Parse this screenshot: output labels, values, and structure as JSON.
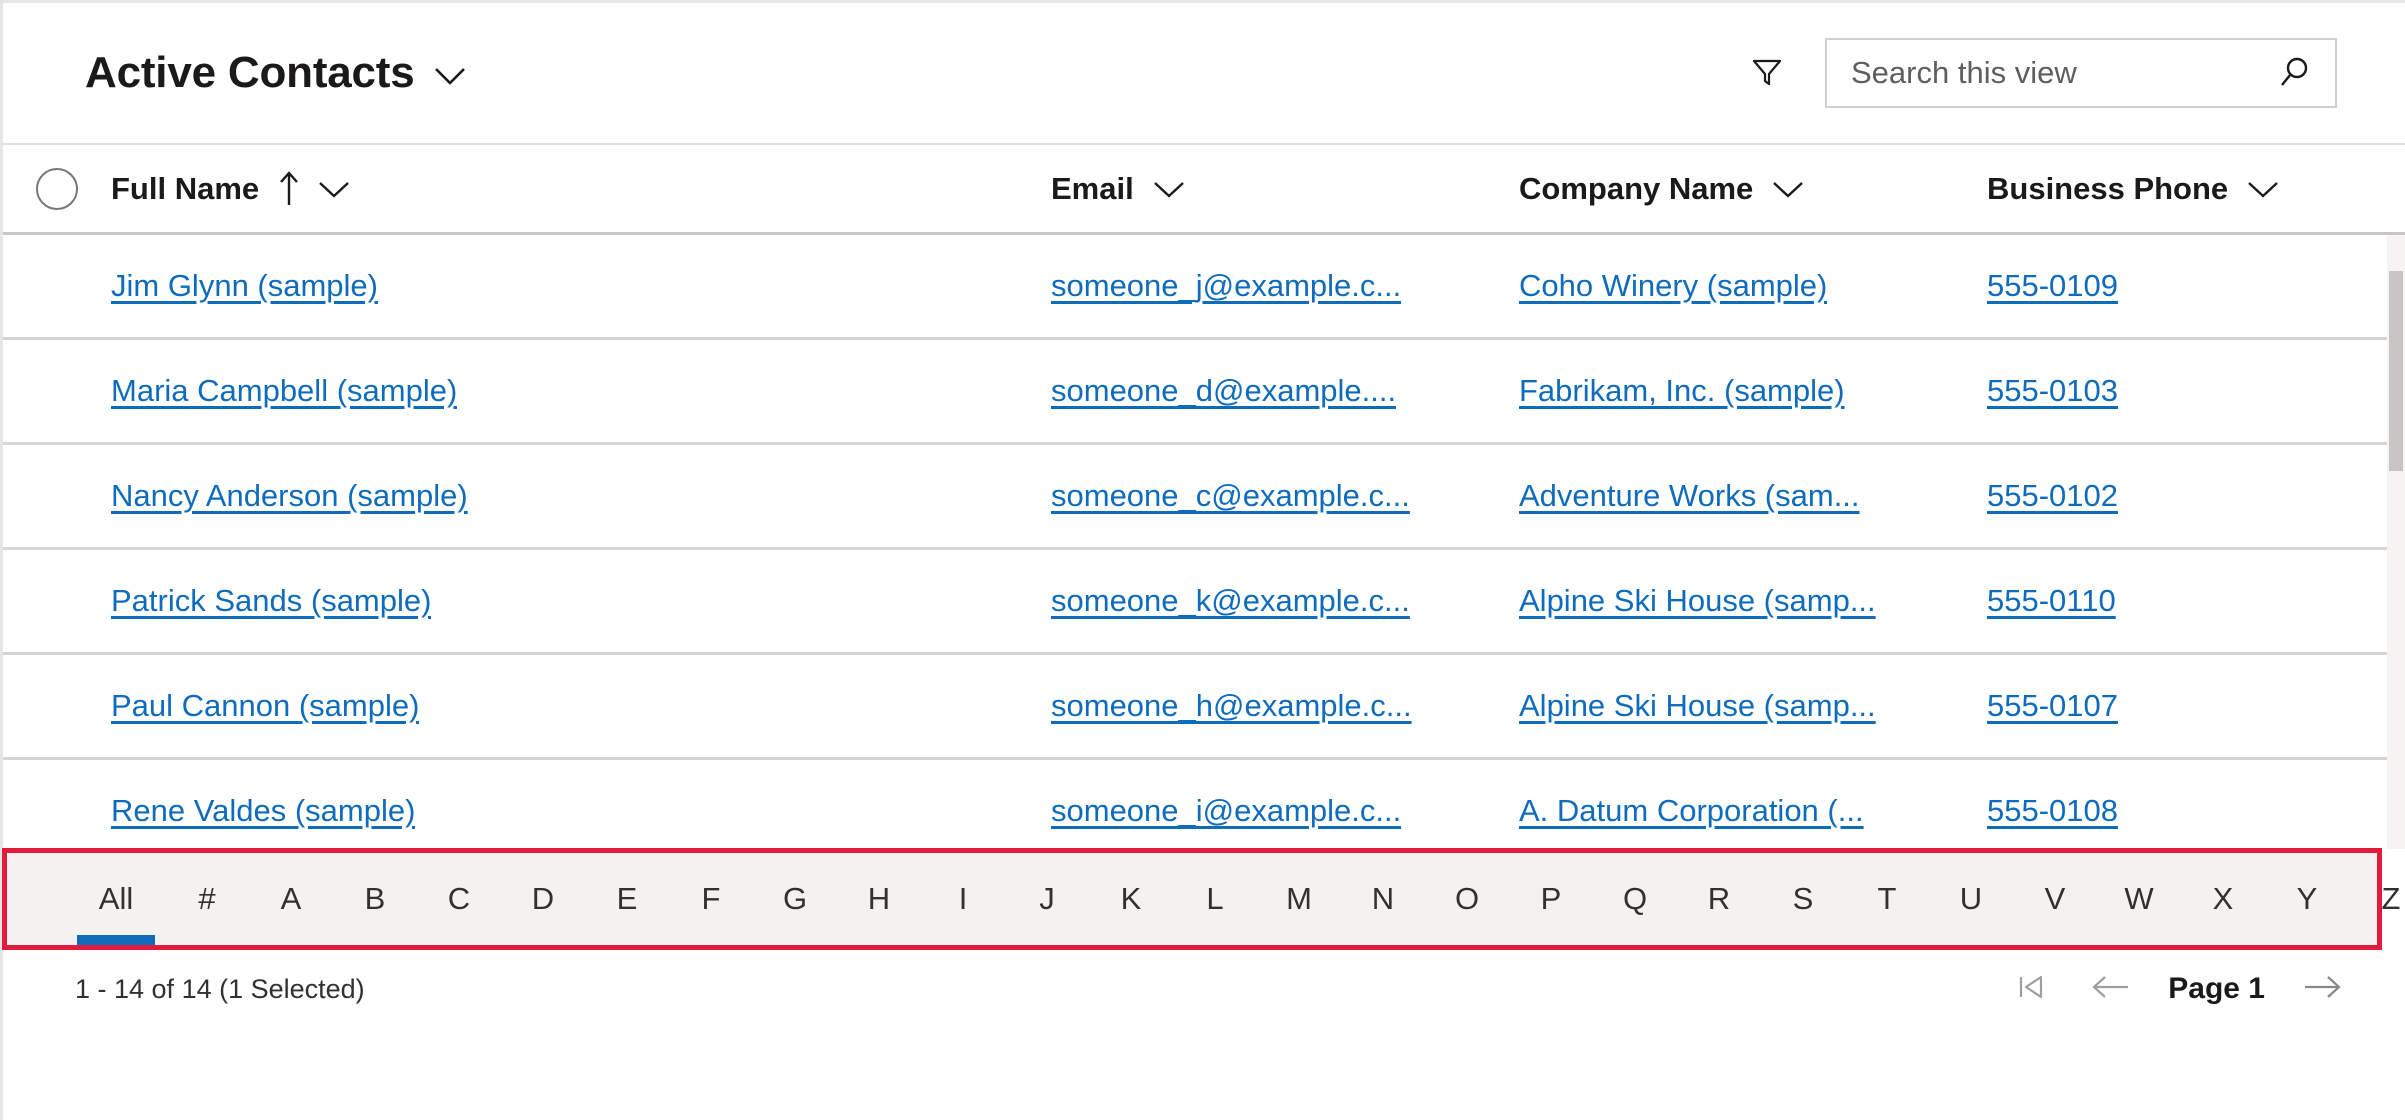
{
  "header": {
    "view_title": "Active Contacts",
    "view_chevron_icon": "chevron-down-icon",
    "filter_icon": "filter-funnel-icon",
    "search_icon": "search-magnifier-icon",
    "search_placeholder": "Search this view",
    "search_value": ""
  },
  "grid": {
    "select_all_icon": "select-all-circle-icon",
    "columns": [
      {
        "key": "full_name",
        "label": "Full Name",
        "sort_icon": "sort-ascending-arrow-icon",
        "chevron_icon": "chevron-down-icon",
        "sorted": true
      },
      {
        "key": "email",
        "label": "Email",
        "chevron_icon": "chevron-down-icon",
        "sorted": false
      },
      {
        "key": "company_name",
        "label": "Company Name",
        "chevron_icon": "chevron-down-icon",
        "sorted": false
      },
      {
        "key": "business_phone",
        "label": "Business Phone",
        "chevron_icon": "chevron-down-icon",
        "sorted": false
      }
    ],
    "rows": [
      {
        "full_name": "Jim Glynn (sample)",
        "email": "someone_j@example.c...",
        "company_name": "Coho Winery (sample)",
        "business_phone": "555-0109"
      },
      {
        "full_name": "Maria Campbell (sample)",
        "email": "someone_d@example....",
        "company_name": "Fabrikam, Inc. (sample)",
        "business_phone": "555-0103"
      },
      {
        "full_name": "Nancy Anderson (sample)",
        "email": "someone_c@example.c...",
        "company_name": "Adventure Works (sam...",
        "business_phone": "555-0102"
      },
      {
        "full_name": "Patrick Sands (sample)",
        "email": "someone_k@example.c...",
        "company_name": "Alpine Ski House (samp...",
        "business_phone": "555-0110"
      },
      {
        "full_name": "Paul Cannon (sample)",
        "email": "someone_h@example.c...",
        "company_name": "Alpine Ski House (samp...",
        "business_phone": "555-0107"
      },
      {
        "full_name": "Rene Valdes (sample)",
        "email": "someone_i@example.c...",
        "company_name": "A. Datum Corporation (...",
        "business_phone": "555-0108"
      }
    ]
  },
  "alpha_index": {
    "highlight_color": "#e21b3c",
    "active_indicator_color": "#0f6cbd",
    "active": "All",
    "items": [
      "All",
      "#",
      "A",
      "B",
      "C",
      "D",
      "E",
      "F",
      "G",
      "H",
      "I",
      "J",
      "K",
      "L",
      "M",
      "N",
      "O",
      "P",
      "Q",
      "R",
      "S",
      "T",
      "U",
      "V",
      "W",
      "X",
      "Y",
      "Z"
    ]
  },
  "footer": {
    "record_count": "1 - 14 of 14 (1 Selected)",
    "first_page_icon": "first-page-icon",
    "previous_page_icon": "previous-page-arrow-icon",
    "page_label": "Page 1",
    "next_page_icon": "next-page-arrow-icon"
  },
  "colors": {
    "link": "#0f6cbd",
    "text": "#1b1a19",
    "row_border": "#d6d4d2",
    "alpha_bar_bg": "#f3f2f1"
  }
}
